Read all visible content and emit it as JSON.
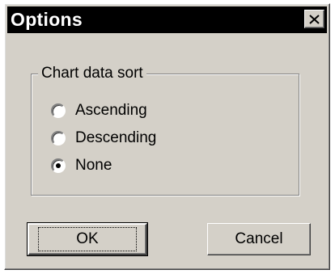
{
  "dialog": {
    "title": "Options",
    "close_icon": "close-icon"
  },
  "group": {
    "label": "Chart data sort",
    "options": [
      {
        "label": "Ascending",
        "checked": false
      },
      {
        "label": "Descending",
        "checked": false
      },
      {
        "label": "None",
        "checked": true
      }
    ]
  },
  "buttons": {
    "ok_label": "OK",
    "cancel_label": "Cancel"
  }
}
